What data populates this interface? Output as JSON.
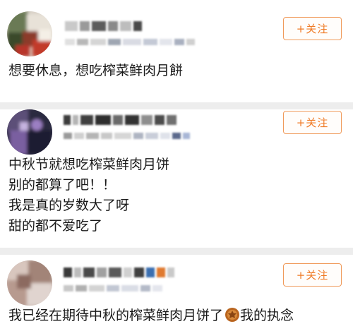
{
  "posts": [
    {
      "follow_label": "+关注",
      "content_lines": [
        "想要休息，想吃榨菜鲜肉月餅"
      ],
      "avatar_icon": "blurred-avatar"
    },
    {
      "follow_label": "+关注",
      "content_lines": [
        "中秋节就想吃榨菜鲜肉月饼",
        "别的都算了吧！！",
        "我是真的岁数大了呀",
        "甜的都不爱吃了"
      ],
      "avatar_icon": "blurred-avatar"
    },
    {
      "follow_label": "+关注",
      "content_lines": [
        "我已经在期待中秋的榨菜鲜肉月饼了"
      ],
      "trailing_text": "我的执念",
      "emoji_icon": "mooncake-emoji-icon",
      "avatar_icon": "blurred-avatar"
    }
  ],
  "colors": {
    "accent": "#ef7a25",
    "separator": "#ededed",
    "text": "#1a1a1a"
  }
}
